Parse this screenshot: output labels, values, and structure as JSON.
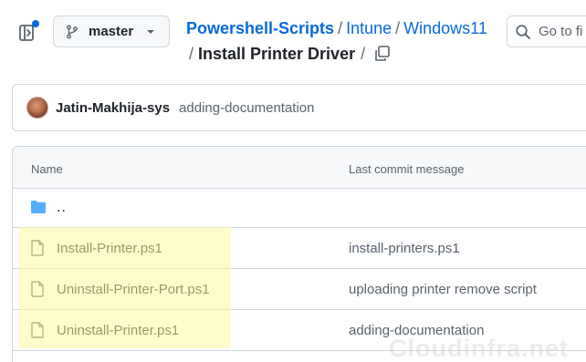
{
  "header": {
    "branch": "master",
    "breadcrumb": {
      "repo": "Powershell-Scripts",
      "sep1": "/",
      "folder1": "Intune",
      "sep2": "/",
      "folder2": "Windows11",
      "sep3": "/",
      "current": "Install Printer Driver",
      "sep4": "/"
    },
    "goto_placeholder": "Go to fi"
  },
  "latest_commit": {
    "author": "Jatin-Makhija-sys",
    "message": "adding-documentation"
  },
  "table": {
    "headers": {
      "name": "Name",
      "commit": "Last commit message"
    },
    "parent_dir": "..",
    "files": [
      {
        "name": "Install-Printer.ps1",
        "commit": "install-printers.ps1"
      },
      {
        "name": "Uninstall-Printer-Port.ps1",
        "commit": "uploading printer remove script"
      },
      {
        "name": "Uninstall-Printer.ps1",
        "commit": "adding-documentation"
      }
    ]
  },
  "watermark": "Cloudinfra.net",
  "colors": {
    "link": "#0969da",
    "folder": "#54aeff",
    "highlight": "#fffaa0"
  }
}
